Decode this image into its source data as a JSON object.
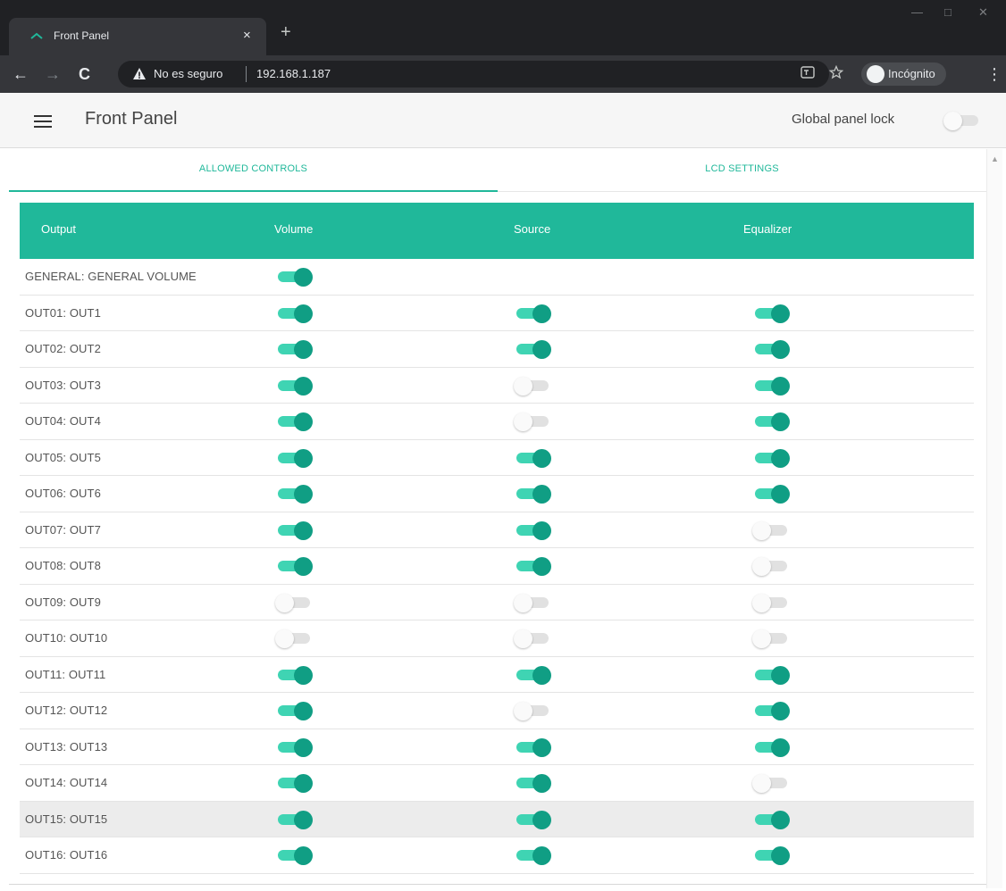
{
  "browser": {
    "tab_title": "Front Panel",
    "tab_close": "×",
    "new_tab": "+",
    "security_text": "No es seguro",
    "url": "192.168.1.187",
    "incognito_label": "Incógnito",
    "nav": {
      "back": "←",
      "forward": "→",
      "reload": "C"
    },
    "window": {
      "minimize": "—",
      "maximize": "□",
      "close": "✕"
    }
  },
  "app": {
    "title": "Front Panel",
    "global_lock_label": "Global panel lock",
    "global_lock_on": false
  },
  "tabs": [
    {
      "label": "ALLOWED CONTROLS",
      "active": true
    },
    {
      "label": "LCD SETTINGS",
      "active": false
    }
  ],
  "table": {
    "headers": {
      "output": "Output",
      "volume": "Volume",
      "source": "Source",
      "equalizer": "Equalizer"
    },
    "rows": [
      {
        "label": "GENERAL: GENERAL VOLUME",
        "volume": true,
        "source": null,
        "equalizer": null
      },
      {
        "label": "OUT01: OUT1",
        "volume": true,
        "source": true,
        "equalizer": true
      },
      {
        "label": "OUT02: OUT2",
        "volume": true,
        "source": true,
        "equalizer": true
      },
      {
        "label": "OUT03: OUT3",
        "volume": true,
        "source": false,
        "equalizer": true
      },
      {
        "label": "OUT04: OUT4",
        "volume": true,
        "source": false,
        "equalizer": true
      },
      {
        "label": "OUT05: OUT5",
        "volume": true,
        "source": true,
        "equalizer": true
      },
      {
        "label": "OUT06: OUT6",
        "volume": true,
        "source": true,
        "equalizer": true
      },
      {
        "label": "OUT07: OUT7",
        "volume": true,
        "source": true,
        "equalizer": false
      },
      {
        "label": "OUT08: OUT8",
        "volume": true,
        "source": true,
        "equalizer": false
      },
      {
        "label": "OUT09: OUT9",
        "volume": false,
        "source": false,
        "equalizer": false
      },
      {
        "label": "OUT10: OUT10",
        "volume": false,
        "source": false,
        "equalizer": false
      },
      {
        "label": "OUT11: OUT11",
        "volume": true,
        "source": true,
        "equalizer": true
      },
      {
        "label": "OUT12: OUT12",
        "volume": true,
        "source": false,
        "equalizer": true
      },
      {
        "label": "OUT13: OUT13",
        "volume": true,
        "source": true,
        "equalizer": true
      },
      {
        "label": "OUT14: OUT14",
        "volume": true,
        "source": true,
        "equalizer": false
      },
      {
        "label": "OUT15: OUT15",
        "volume": true,
        "source": true,
        "equalizer": true,
        "highlighted": true
      },
      {
        "label": "OUT16: OUT16",
        "volume": true,
        "source": true,
        "equalizer": true
      }
    ]
  },
  "colors": {
    "accent": "#20b89a",
    "toggle_on_track": "#3fd4b3",
    "toggle_on_knob": "#109e84",
    "toggle_off_track": "#e1e1e1"
  }
}
